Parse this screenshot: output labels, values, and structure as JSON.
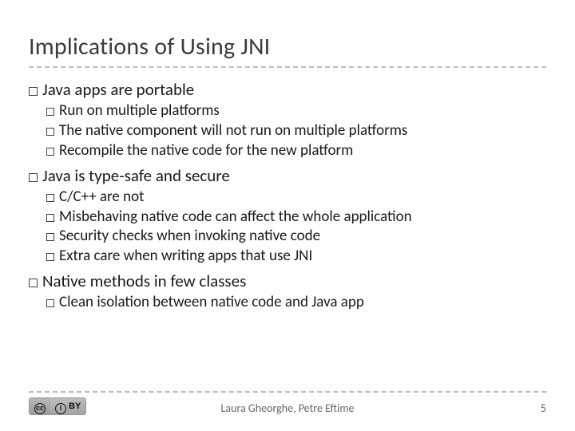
{
  "title": "Implications of Using JNI",
  "bullets": {
    "b1": "Java apps are portable",
    "b1_1": "Run on multiple platforms",
    "b1_2": "The native component will not run on multiple platforms",
    "b1_3": "Recompile the native code for the new platform",
    "b2": "Java is type-safe and secure",
    "b2_1": "C/C++ are not",
    "b2_2": "Misbehaving native code can affect the whole application",
    "b2_3": "Security checks when invoking native code",
    "b2_4": "Extra care when writing apps that use JNI",
    "b3": "Native methods in few classes",
    "b3_1": "Clean isolation between native code and Java app"
  },
  "footer": {
    "cc_left": "cc",
    "cc_by_glyph": "i",
    "cc_by_text": " BY",
    "authors": "Laura Gheorghe, Petre Eftime",
    "page": "5"
  }
}
